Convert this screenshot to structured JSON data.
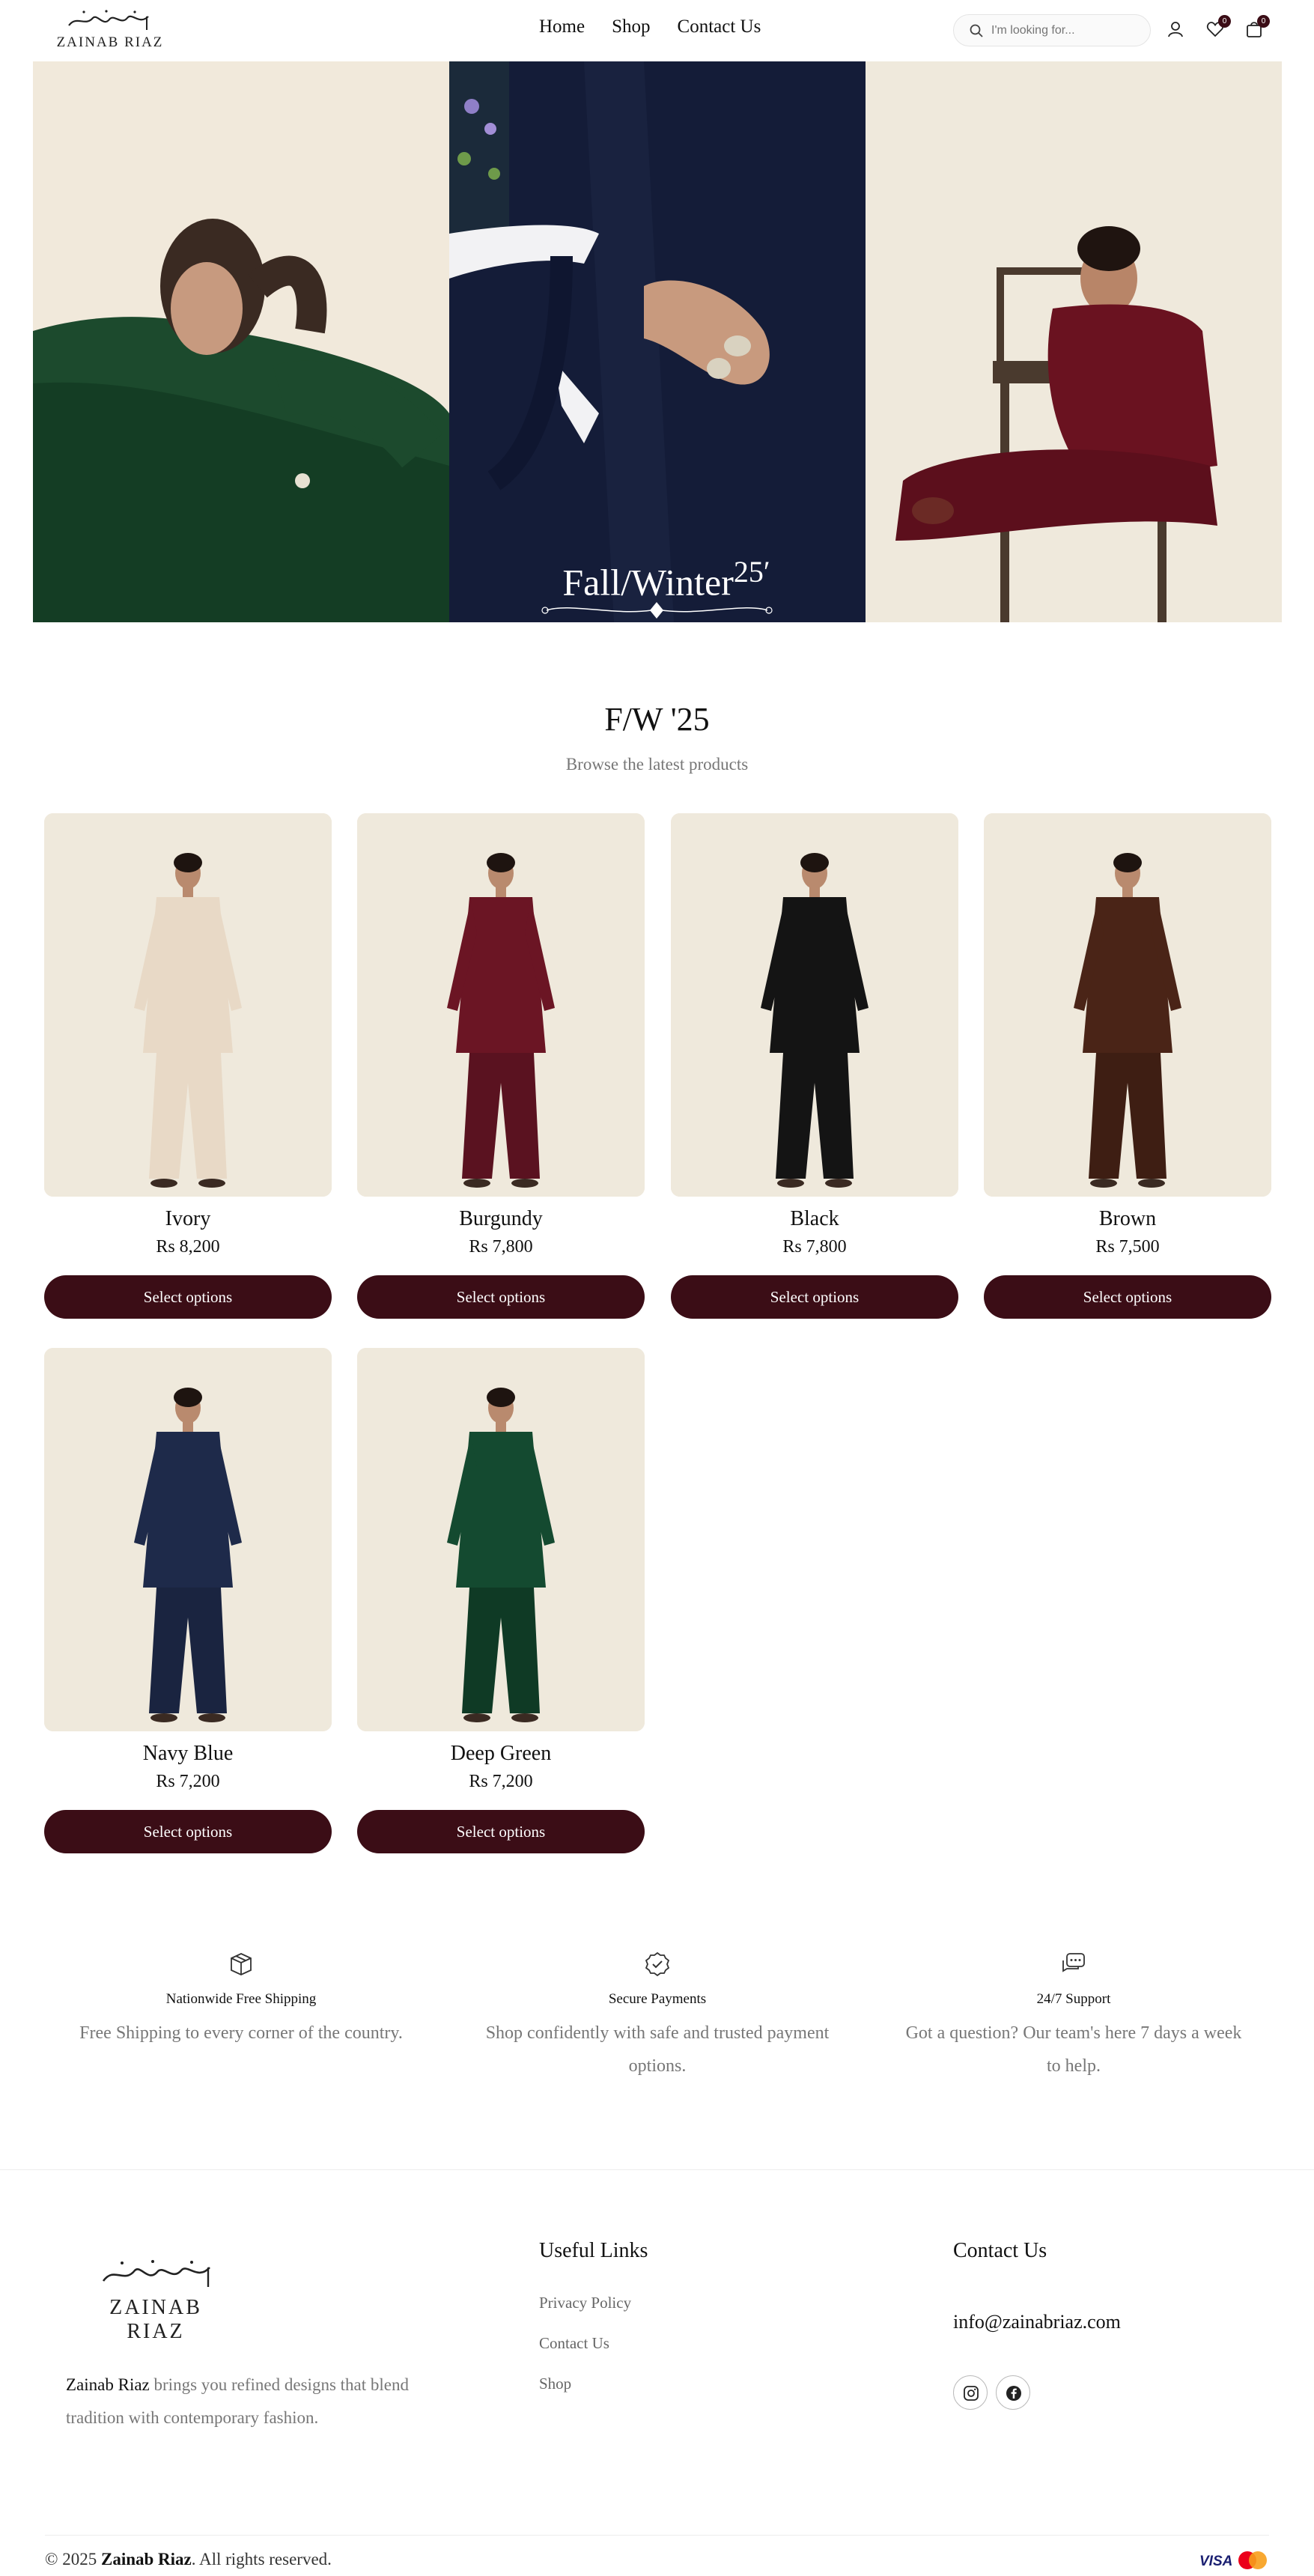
{
  "brand": {
    "name": "ZAINAB RIAZ",
    "script": "زینب ریاض"
  },
  "nav": {
    "items": [
      "Home",
      "Shop",
      "Contact Us"
    ]
  },
  "search": {
    "placeholder": "I'm looking for..."
  },
  "header_icons": {
    "wishlist_count": "0",
    "cart_count": "0"
  },
  "hero": {
    "title": "Fall/Winter",
    "year": "25"
  },
  "collection": {
    "title": "F/W '25",
    "subtitle": "Browse the latest products"
  },
  "products": [
    {
      "name": "Ivory",
      "price": "Rs 8,200",
      "button": "Select options",
      "top_color": "#e8d9c6",
      "bottom_color": "#e8d9c6"
    },
    {
      "name": "Burgundy",
      "price": "Rs 7,800",
      "button": "Select options",
      "top_color": "#6b1524",
      "bottom_color": "#5a1220"
    },
    {
      "name": "Black",
      "price": "Rs 7,800",
      "button": "Select options",
      "top_color": "#141414",
      "bottom_color": "#141414"
    },
    {
      "name": "Brown",
      "price": "Rs 7,500",
      "button": "Select options",
      "top_color": "#4a2417",
      "bottom_color": "#3e1e13"
    },
    {
      "name": "Navy Blue",
      "price": "Rs 7,200",
      "button": "Select options",
      "top_color": "#1e2a4a",
      "bottom_color": "#1a2440"
    },
    {
      "name": "Deep Green",
      "price": "Rs 7,200",
      "button": "Select options",
      "top_color": "#144a30",
      "bottom_color": "#0f3a25"
    }
  ],
  "features": [
    {
      "icon": "box-icon",
      "title": "Nationwide Free Shipping",
      "desc": "Free Shipping to every corner of the country."
    },
    {
      "icon": "badge-check-icon",
      "title": "Secure Payments",
      "desc": "Shop confidently with safe and trusted payment options."
    },
    {
      "icon": "chat-icon",
      "title": "24/7 Support",
      "desc": "Got a question? Our team's here 7 days a week to help."
    }
  ],
  "footer": {
    "about_brand": "Zainab Riaz",
    "about_text": " brings you refined designs that blend tradition with contemporary fashion.",
    "links_title": "Useful Links",
    "links": [
      "Privacy Policy",
      "Contact Us",
      "Shop"
    ],
    "contact_title": "Contact Us",
    "email": "info@zainabriaz.com",
    "copyright_prefix": "© 2025 ",
    "copyright_brand": "Zainab Riaz",
    "copyright_suffix": ". All rights reserved.",
    "payment": [
      "VISA",
      "MasterCard"
    ]
  },
  "colors": {
    "accent": "#3b0d16",
    "muted_text": "#777777",
    "product_bg": "#efe9dc"
  }
}
